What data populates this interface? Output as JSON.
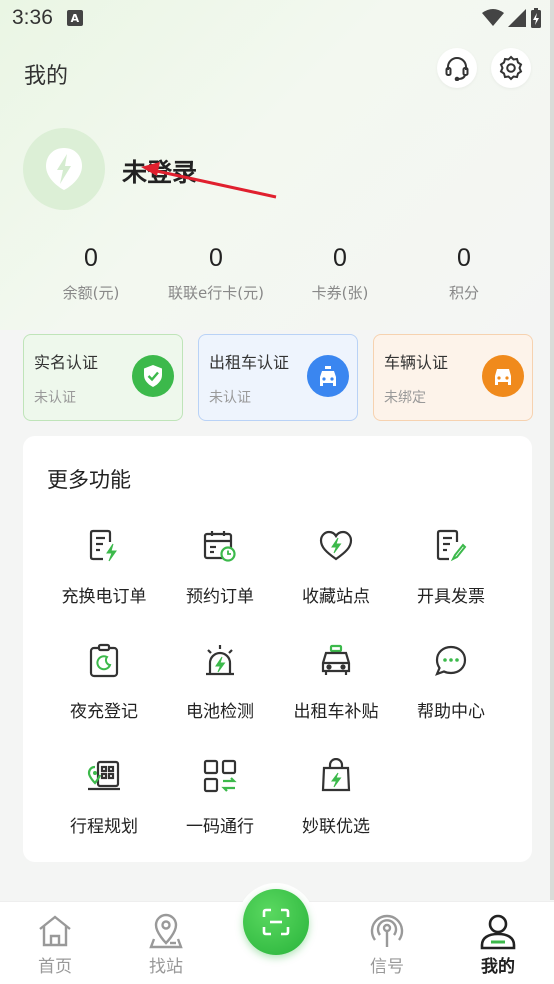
{
  "status_bar": {
    "time": "3:36",
    "notif_letter": "A"
  },
  "header": {
    "title": "我的"
  },
  "profile": {
    "name": "未登录"
  },
  "stats": [
    {
      "value": "0",
      "label": "余额(元)"
    },
    {
      "value": "0",
      "label": "联联e行卡(元)"
    },
    {
      "value": "0",
      "label": "卡券(张)"
    },
    {
      "value": "0",
      "label": "积分"
    }
  ],
  "certs": [
    {
      "title": "实名认证",
      "status": "未认证",
      "icon": "shield-check-icon",
      "color": "#3cb94b"
    },
    {
      "title": "出租车认证",
      "status": "未认证",
      "icon": "taxi-icon",
      "color": "#3a86f0"
    },
    {
      "title": "车辆认证",
      "status": "未绑定",
      "icon": "car-icon",
      "color": "#f08a1c"
    }
  ],
  "more": {
    "title": "更多功能",
    "items": [
      {
        "label": "充换电订单",
        "icon": "charge-order-icon"
      },
      {
        "label": "预约订单",
        "icon": "calendar-clock-icon"
      },
      {
        "label": "收藏站点",
        "icon": "heart-bolt-icon"
      },
      {
        "label": "开具发票",
        "icon": "invoice-pen-icon"
      },
      {
        "label": "夜充登记",
        "icon": "night-charge-icon"
      },
      {
        "label": "电池检测",
        "icon": "battery-alarm-icon"
      },
      {
        "label": "出租车补贴",
        "icon": "taxi-front-icon"
      },
      {
        "label": "帮助中心",
        "icon": "chat-bubble-icon"
      },
      {
        "label": "行程规划",
        "icon": "trip-plan-icon"
      },
      {
        "label": "一码通行",
        "icon": "qr-transfer-icon"
      },
      {
        "label": "妙联优选",
        "icon": "shopping-bag-bolt-icon"
      }
    ]
  },
  "nav": {
    "items": [
      {
        "label": "首页",
        "icon": "home-icon"
      },
      {
        "label": "找站",
        "icon": "location-pin-icon"
      },
      {
        "label": "信号",
        "icon": "signal-icon"
      },
      {
        "label": "我的",
        "icon": "user-icon"
      }
    ],
    "center_icon": "scan-icon"
  },
  "colors": {
    "accent": "#3cb94b",
    "annotation": "#e0202e"
  }
}
